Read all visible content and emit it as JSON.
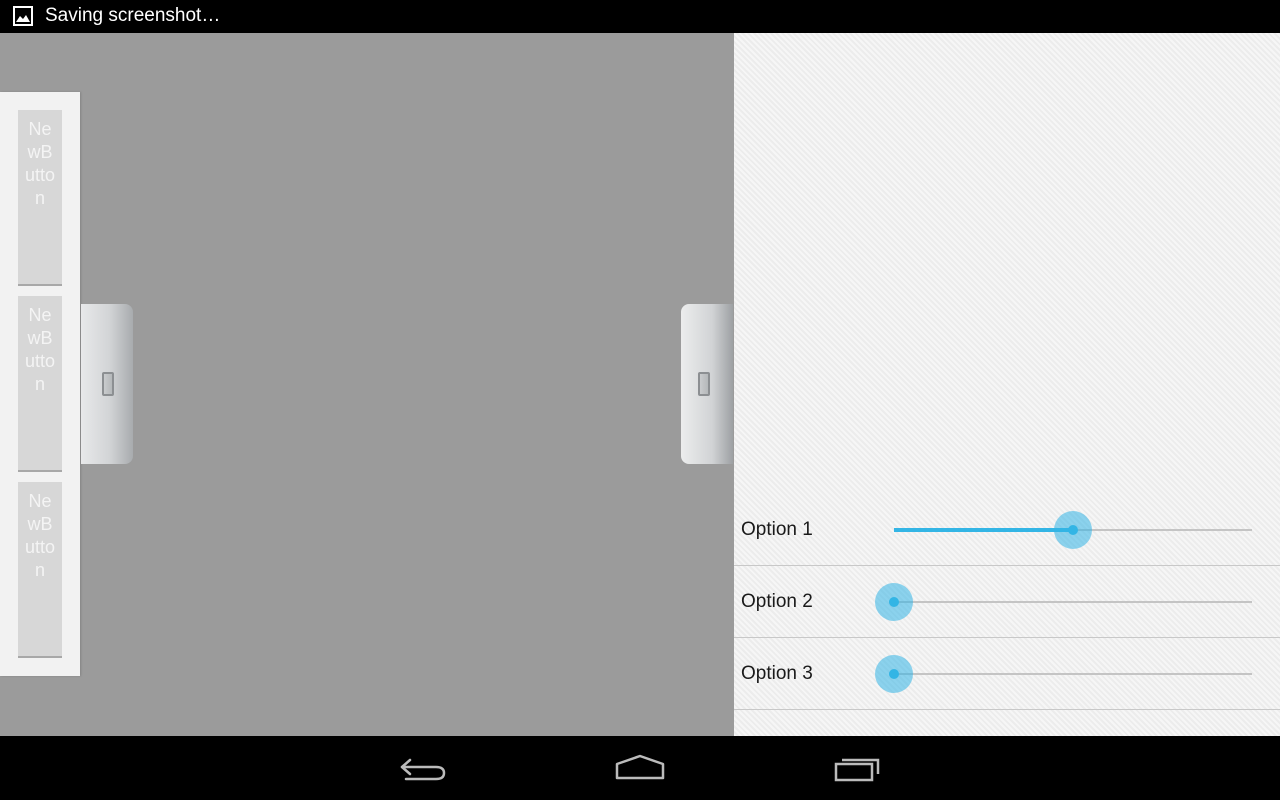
{
  "status_bar": {
    "notification_text": "Saving screenshot…",
    "icon": "image-icon"
  },
  "button_panel": {
    "buttons": [
      {
        "label": "NewButton"
      },
      {
        "label": "NewButton"
      },
      {
        "label": "NewButton"
      }
    ]
  },
  "drawer_handles": [
    "grip-icon",
    "grip-icon"
  ],
  "options": [
    {
      "label": "Option 1",
      "value_fraction": 0.5
    },
    {
      "label": "Option 2",
      "value_fraction": 0.0
    },
    {
      "label": "Option 3",
      "value_fraction": 0.0
    }
  ],
  "colors": {
    "accent": "#33b5e5",
    "left_area_bg": "#9b9b9b",
    "right_panel_bg": "#f1f1f1"
  },
  "nav_bar": {
    "icons": [
      "back-icon",
      "home-icon",
      "recent-apps-icon"
    ]
  }
}
